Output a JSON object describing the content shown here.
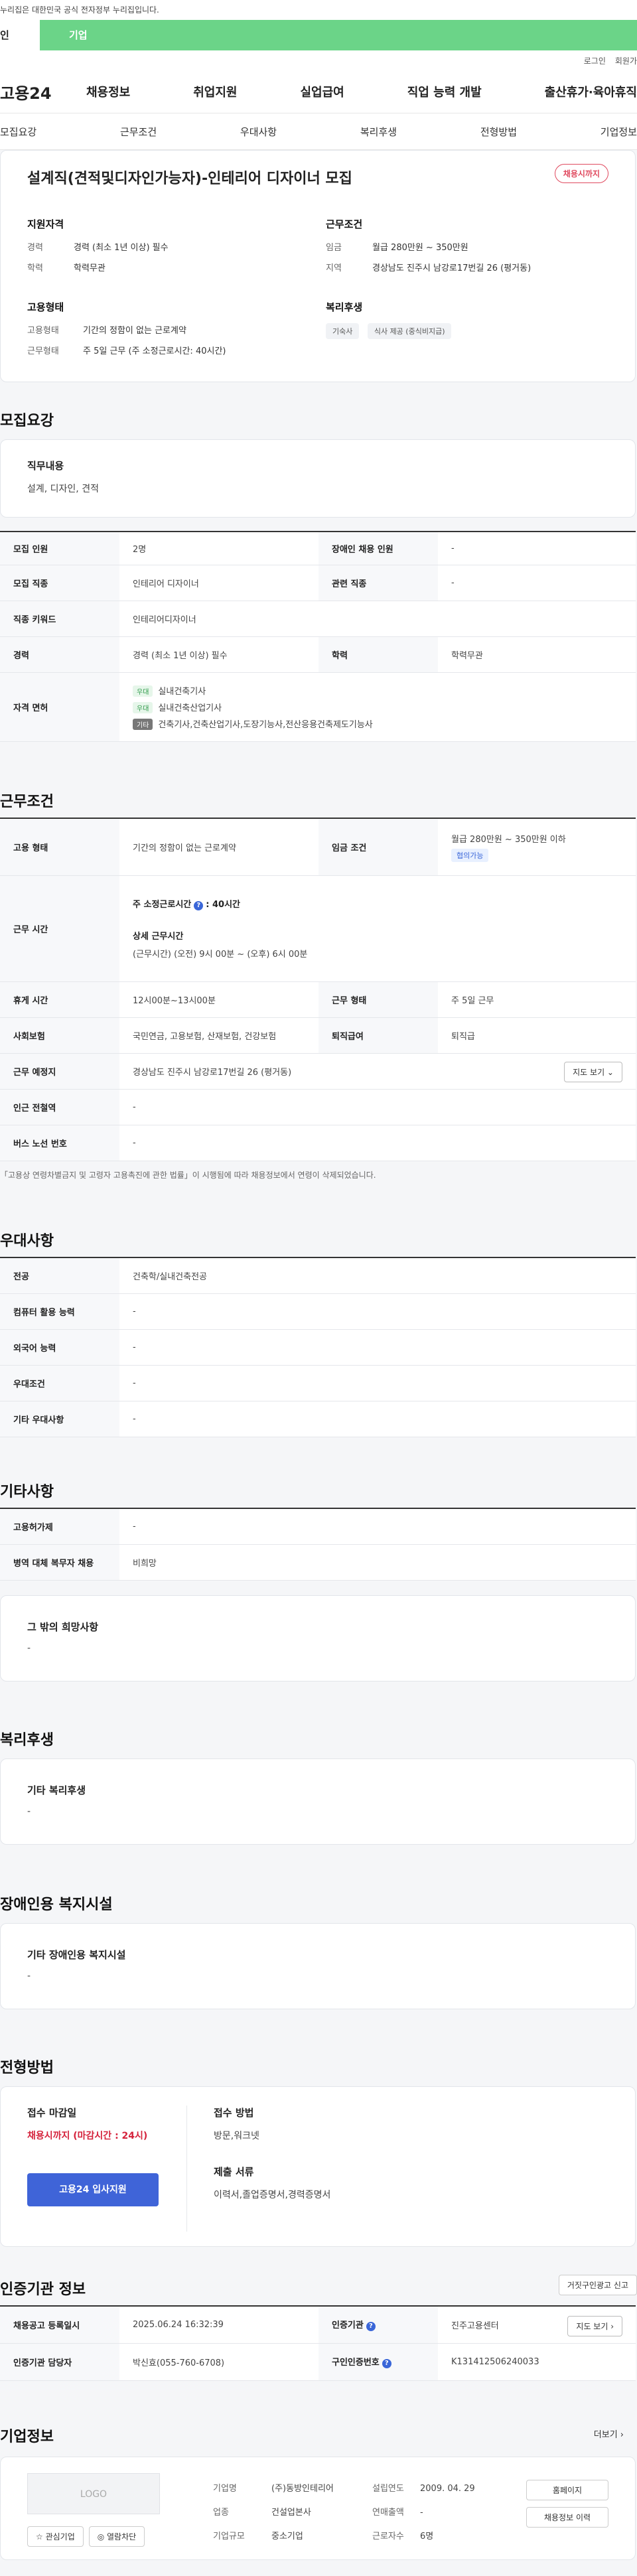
{
  "gov_notice": "누리집은 대한민국 공식 전자정부 누리집입니다.",
  "top_tabs": [
    "인",
    "기업"
  ],
  "util": [
    "로그인",
    "회원가"
  ],
  "logo": "고용24",
  "gnb": [
    "채용정보",
    "취업지원",
    "실업급여",
    "직업 능력 개발",
    "출산휴가·육아휴직"
  ],
  "subnav": [
    "모집요강",
    "근무조건",
    "우대사항",
    "복리후생",
    "전형방법",
    "기업정보"
  ],
  "summary": {
    "title": "설계직(견적및디자인가능자)-인테리어 디자이너 모집",
    "status": "채용시까지",
    "qual_title": "지원자격",
    "career_k": "경력",
    "career_v": "경력 (최소 1년 이상) 필수",
    "edu_k": "학력",
    "edu_v": "학력무관",
    "cond_title": "근무조건",
    "wage_k": "임금",
    "wage_v": "월급 280만원 ~ 350만원",
    "area_k": "지역",
    "area_v": "경상남도 진주시 남강로17번길 26 (평거동)",
    "emp_title": "고용형태",
    "emptype_k": "고용형태",
    "emptype_v": "기간의 정함이 없는 근로계약",
    "worktype_k": "근무형태",
    "worktype_v": "주 5일 근무 (주 소정근로시간: 40시간)",
    "welfare_title": "복리후생",
    "chips": [
      "기숙사",
      "식사 제공 (중식비지급)"
    ]
  },
  "recruit": {
    "title": "모집요강",
    "duty_label": "직무내용",
    "duty_value": "설계, 디자인, 견적",
    "rows": {
      "count_h": "모집 인원",
      "count_v": "2명",
      "disabled_h": "장애인 채용 인원",
      "disabled_v": "-",
      "job_h": "모집 직종",
      "job_v": "인테리어 디자이너",
      "related_h": "관련 직종",
      "related_v": "-",
      "keyword_h": "직종 키워드",
      "keyword_v": "인테리어디자이너",
      "career_h": "경력",
      "career_v": "경력 (최소 1년 이상) 필수",
      "edu_h": "학력",
      "edu_v": "학력무관",
      "license_h": "자격 면허"
    },
    "licenses": [
      {
        "tag": "우대",
        "name": "실내건축기사"
      },
      {
        "tag": "우대",
        "name": "실내건축산업기사"
      },
      {
        "tag": "기타",
        "name": "건축기사,건축산업기사,도장기능사,전산응용건축제도기능사"
      }
    ]
  },
  "work": {
    "title": "근무조건",
    "emp_h": "고용 형태",
    "emp_v": "기간의 정함이 없는 근로계약",
    "wage_h": "임금 조건",
    "wage_v": "월급 280만원 ~ 350만원 이하",
    "wage_tag": "협의가능",
    "hours_h": "근무 시간",
    "hours_main": "주 소정근로시간",
    "hours_value": ": 40시간",
    "detail_label": "상세 근무시간",
    "detail_value": "(근무시간) (오전) 9시 00분 ~ (오후) 6시 00분",
    "break_h": "휴게 시간",
    "break_v": "12시00분~13시00분",
    "form_h": "근무 형태",
    "form_v": "주 5일 근무",
    "ins_h": "사회보험",
    "ins_v": "국민연금, 고용보험, 산재보험, 건강보험",
    "sev_h": "퇴직급여",
    "sev_v": "퇴직급",
    "place_h": "근무 예정지",
    "place_v": "경상남도 진주시 남강로17번길 26 (평거동)",
    "map_btn": "지도 보기 ⌄",
    "station_h": "인근 전철역",
    "station_v": "-",
    "bus_h": "버스 노선 번호",
    "bus_v": "-",
    "note": "「고용상 연령차별금지 및 고령자 고용촉진에 관한 법률」이 시행됨에 따라 채용정보에서 연령이 삭제되었습니다."
  },
  "pref": {
    "title": "우대사항",
    "major_h": "전공",
    "major_v": "건축학/실내건축전공",
    "pc_h": "컴퓨터 활용 능력",
    "pc_v": "-",
    "lang_h": "외국어 능력",
    "lang_v": "-",
    "cond_h": "우대조건",
    "cond_v": "-",
    "etc_h": "기타 우대사항",
    "etc_v": "-"
  },
  "misc": {
    "title": "기타사항",
    "emp_h": "고용허가제",
    "emp_v": "-",
    "mil_h": "병역 대체 복무자 채용",
    "mil_v": "비희망",
    "wish_label": "그 밖의 희망사항",
    "wish_value": "-"
  },
  "welfare": {
    "title": "복리후생",
    "label": "기타 복리후생",
    "value": "-"
  },
  "facility": {
    "title": "장애인용 복지시설",
    "label": "기타 장애인용 복지시설",
    "value": "-"
  },
  "process": {
    "title": "전형방법",
    "deadline_label": "접수 마감일",
    "deadline_value": "채용시까지 (마감시간 : 24시)",
    "apply_btn": "고용24 입사지원",
    "method_label": "접수 방법",
    "method_value": "방문,워크넷",
    "docs_label": "제출 서류",
    "docs_value": "이력서,졸업증명서,경력증명서"
  },
  "cert": {
    "title": "인증기관 정보",
    "report_btn": "거짓구인광고 신고",
    "reg_h": "채용공고 등록일시",
    "reg_v": "2025.06.24 16:32:39",
    "org_h": "인증기관",
    "org_v": "진주고용센터",
    "map_btn": "지도 보기 ›",
    "mgr_h": "인증기관 담당자",
    "mgr_v": "박신효(055-760-6708)",
    "num_h": "구인인증번호",
    "num_v": "K131412506240033"
  },
  "company": {
    "title": "기업정보",
    "more": "더보기 ›",
    "logo_text": "LOGO",
    "fav_btn": "☆ 관심기업",
    "block_btn": "◎ 열람차단",
    "name_k": "기업명",
    "name_v": "(주)동방인테리어",
    "year_k": "설립연도",
    "year_v": "2009. 04. 29",
    "ind_k": "업종",
    "ind_v": "건설업본사",
    "sales_k": "연매출액",
    "sales_v": "-",
    "size_k": "기업규모",
    "size_v": "중소기업",
    "emp_k": "근로자수",
    "emp_v": "6명",
    "home_btn": "홈페이지",
    "jobs_btn": "채용정보 이력"
  },
  "colors": {
    "green": "#6bd488",
    "blue": "#3f64d8",
    "red": "#d5223b"
  }
}
